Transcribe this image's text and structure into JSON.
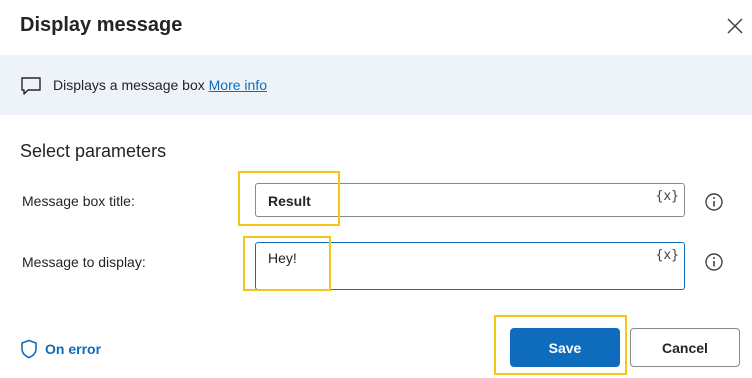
{
  "dialog": {
    "title": "Display message"
  },
  "info": {
    "text": "Displays a message box ",
    "link": "More info"
  },
  "params": {
    "section_title": "Select parameters",
    "title_field": {
      "label": "Message box title:",
      "value": "Result",
      "var_button": "{x}"
    },
    "message_field": {
      "label": "Message to display:",
      "value": "Hey!",
      "var_button": "{x}"
    }
  },
  "footer": {
    "on_error": "On error",
    "save": "Save",
    "cancel": "Cancel"
  },
  "colors": {
    "accent": "#0f6cbd",
    "info_background": "#eef3fa",
    "highlight": "#f5c518"
  }
}
